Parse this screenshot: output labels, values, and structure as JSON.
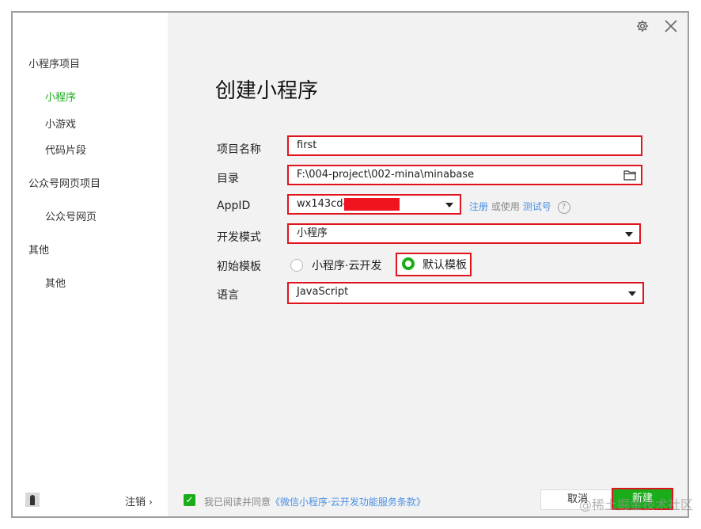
{
  "sidebar": {
    "groups": [
      {
        "label": "小程序项目",
        "items": [
          "小程序",
          "小游戏",
          "代码片段"
        ]
      },
      {
        "label": "公众号网页项目",
        "items": [
          "公众号网页"
        ]
      },
      {
        "label": "其他",
        "items": [
          "其他"
        ]
      }
    ],
    "active_item": "小程序",
    "logout_label": "注销"
  },
  "main": {
    "title": "创建小程序",
    "form": {
      "project_name": {
        "label": "项目名称",
        "value": "first"
      },
      "directory": {
        "label": "目录",
        "value": "F:\\004-project\\002-mina\\minabase"
      },
      "appid": {
        "label": "AppID",
        "value": "wx143cd4"
      },
      "appid_help": {
        "register": "注册",
        "or_use": "或使用",
        "test_account": "测试号",
        "help_icon": "?"
      },
      "dev_mode": {
        "label": "开发模式",
        "value": "小程序"
      },
      "template": {
        "label": "初始模板",
        "options": [
          "小程序·云开发",
          "默认模板"
        ],
        "selected": "默认模板"
      },
      "language": {
        "label": "语言",
        "value": "JavaScript"
      }
    }
  },
  "footer": {
    "agree_prefix": "我已阅读并同意",
    "terms_link": "《微信小程序·云开发功能服务条款》",
    "cancel_label": "取消",
    "create_label": "新建"
  },
  "watermark": "@稀土掘金技术社区",
  "colors": {
    "accent": "#1aad19",
    "highlight": "#e0141e",
    "link": "#4a90e2"
  }
}
